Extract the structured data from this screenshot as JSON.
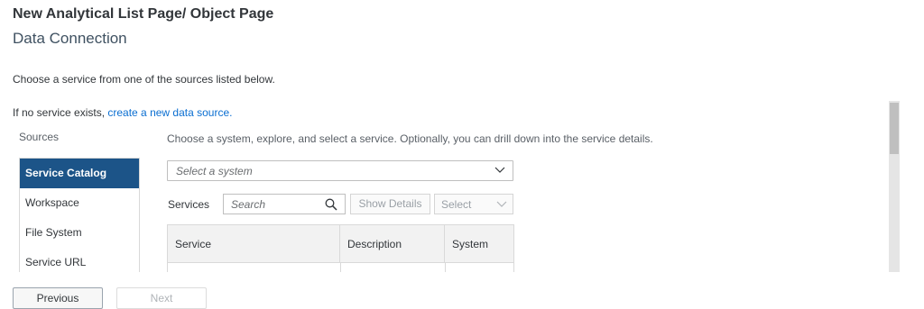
{
  "header": {
    "title": "New Analytical List Page/ Object Page",
    "subtitle": "Data Connection"
  },
  "intro_text": "Choose a service from one of the sources listed below.",
  "no_service": {
    "text": "If no service exists, ",
    "link": "create a new data source."
  },
  "sources": {
    "label": "Sources",
    "items": [
      {
        "label": "Service Catalog",
        "active": true
      },
      {
        "label": "Workspace",
        "active": false
      },
      {
        "label": "File System",
        "active": false
      },
      {
        "label": "Service URL",
        "active": false
      }
    ]
  },
  "main": {
    "instruction": "Choose a system, explore, and select a service. Optionally, you can drill down into the service details.",
    "system_select": {
      "placeholder": "Select a system"
    },
    "services_label": "Services",
    "search": {
      "placeholder": "Search"
    },
    "show_details_label": "Show Details",
    "select_label": "Select",
    "table": {
      "columns": [
        "Service",
        "Description",
        "System"
      ]
    }
  },
  "footer": {
    "previous_label": "Previous",
    "next_label": "Next"
  },
  "colors": {
    "active_item_bg": "#1c5488",
    "link": "#0a6ed1",
    "title": "#32363a"
  }
}
